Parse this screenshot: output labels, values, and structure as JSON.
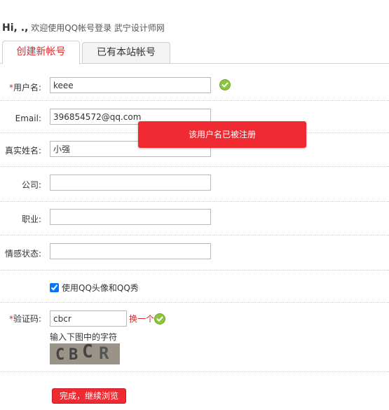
{
  "header": {
    "hi": "Hi, .,",
    "welcome": "欢迎使用QQ帐号登录 武宁设计师网"
  },
  "tabs": [
    {
      "label": "创建新帐号",
      "active": true
    },
    {
      "label": "已有本站帐号",
      "active": false
    }
  ],
  "form": {
    "username": {
      "label": "用户名:",
      "required": true,
      "value": "keee",
      "status": "ok"
    },
    "email": {
      "label": "Email:",
      "required": false,
      "value": "396854572@qq.com"
    },
    "realname": {
      "label": "真实姓名:",
      "required": false,
      "value": "小强"
    },
    "company": {
      "label": "公司:",
      "required": false,
      "value": ""
    },
    "job": {
      "label": "职业:",
      "required": false,
      "value": ""
    },
    "relationship": {
      "label": "情感状态:",
      "required": false,
      "value": ""
    },
    "use_qq_avatar": {
      "label": "使用QQ头像和QQ秀",
      "checked": true
    },
    "captcha": {
      "label": "验证码:",
      "required": true,
      "value": "cbcr",
      "refresh_label": "换一个",
      "hint": "输入下图中的字符",
      "image_text": "CBCR",
      "status": "ok"
    },
    "submit_label": "完成，继续浏览"
  },
  "toast": {
    "message": "该用户名已被注册"
  },
  "colors": {
    "accent_red": "#d9272e",
    "toast_bg": "#ef2a33",
    "ok_green": "#8cc63f"
  },
  "icons": {
    "ok": "checkmark-circle-icon"
  }
}
